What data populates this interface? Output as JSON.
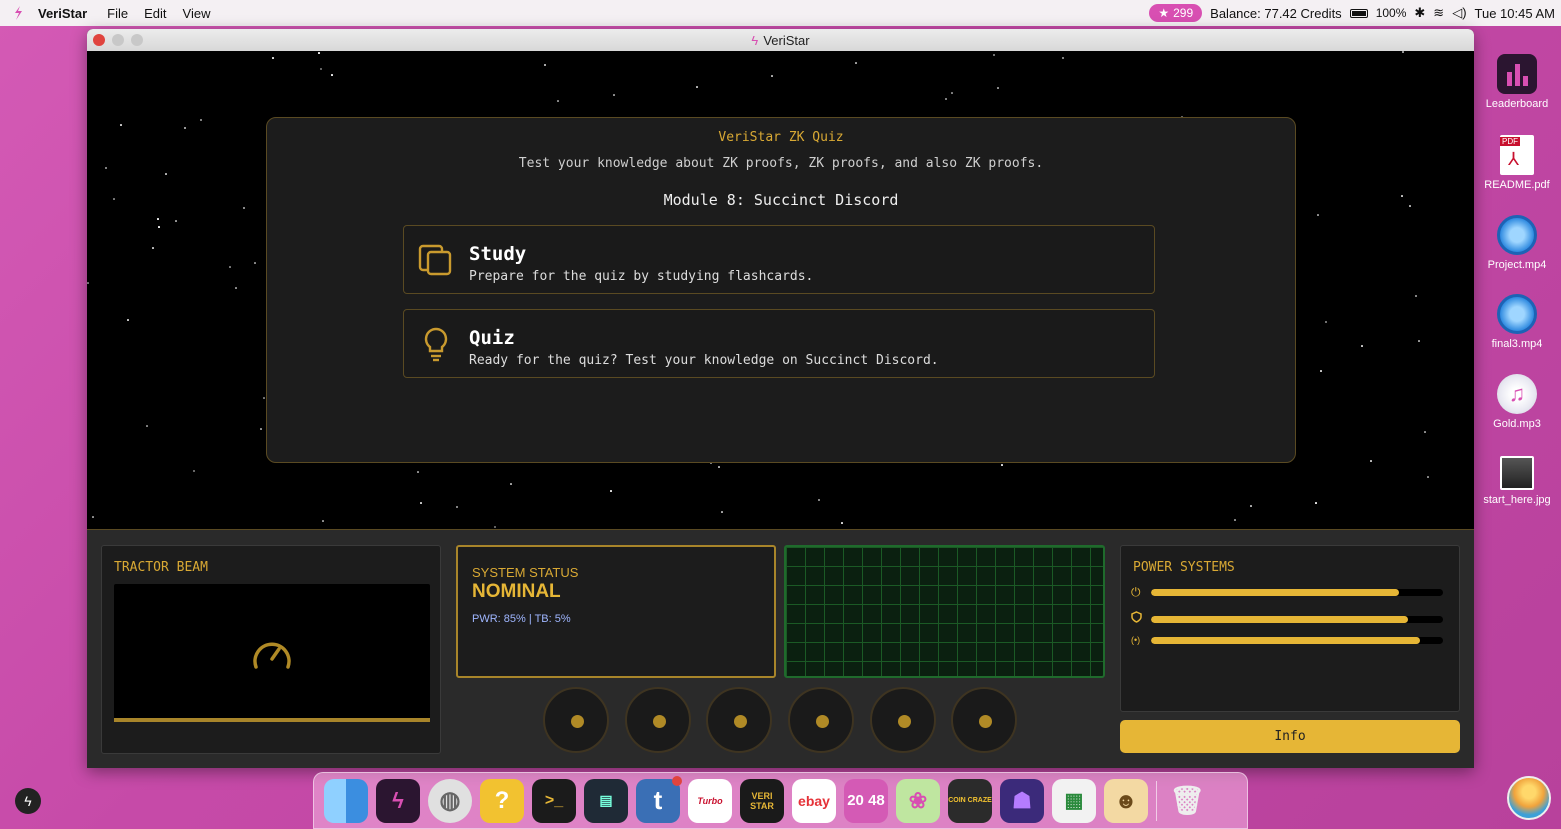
{
  "menubar": {
    "app_name": "VeriStar",
    "menus": [
      "File",
      "Edit",
      "View"
    ],
    "stars": "299",
    "balance": "Balance:  77.42 Credits",
    "battery": "100%",
    "clock": "Tue 10:45 AM"
  },
  "window": {
    "title": "VeriStar"
  },
  "quiz": {
    "title": "VeriStar ZK Quiz",
    "subtitle": "Test your knowledge about ZK proofs, ZK proofs, and also ZK proofs.",
    "module": "Module 8: Succinct Discord",
    "options": [
      {
        "heading": "Study",
        "desc": "Prepare for the quiz by studying flashcards.",
        "icon": "flashcards-icon"
      },
      {
        "heading": "Quiz",
        "desc": "Ready for the quiz? Test your knowledge on Succinct Discord.",
        "icon": "lightbulb-icon"
      }
    ]
  },
  "dashboard": {
    "tractor_label": "TRACTOR BEAM",
    "status_label": "SYSTEM STATUS",
    "status_value": "NOMINAL",
    "status_detail": "PWR: 85% | TB: 5%",
    "power_label": "POWER SYSTEMS",
    "power_bars": [
      {
        "icon": "power-icon",
        "fraction": 0.85
      },
      {
        "icon": "shield-icon",
        "fraction": 0.88
      },
      {
        "icon": "signal-icon",
        "fraction": 0.92
      }
    ],
    "info_label": "Info"
  },
  "desktop_icons": [
    {
      "label": "Leaderboard"
    },
    {
      "label": "README.pdf"
    },
    {
      "label": "Project.mp4"
    },
    {
      "label": "final3.mp4"
    },
    {
      "label": "Gold.mp3"
    },
    {
      "label": "start_here.jpg"
    }
  ],
  "dock": {
    "items": [
      "finder",
      "veristar",
      "network",
      "help",
      "terminal",
      "monitor",
      "tumblr",
      "turbo",
      "veri-star",
      "ebay",
      "2048",
      "candy",
      "coin-craze",
      "monster",
      "solitaire",
      "cat",
      "trash"
    ],
    "labels": {
      "turbo": "Turbo",
      "veristar_game": "VERI STAR",
      "ebay": "ebay",
      "game2048": "20 48",
      "coin": "COIN CRAZE"
    }
  },
  "colors": {
    "accent": "#e6b636",
    "border": "#5a4a22",
    "grid": "#1f6b2c",
    "desktop": "#c64aa8"
  }
}
